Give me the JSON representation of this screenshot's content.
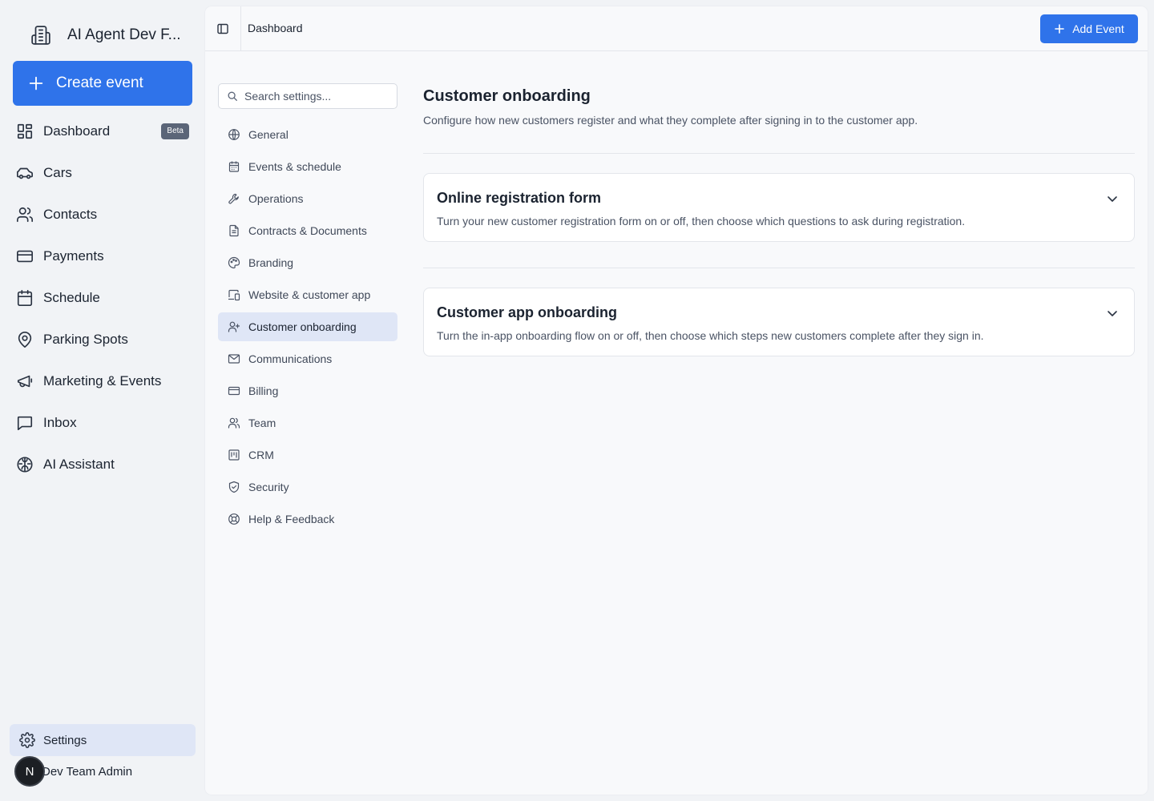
{
  "sidebar": {
    "brand_name": "AI Agent Dev F...",
    "create_label": "Create event",
    "items": [
      {
        "label": "Dashboard",
        "icon": "dashboard-icon",
        "badge": "Beta"
      },
      {
        "label": "Cars",
        "icon": "car-icon"
      },
      {
        "label": "Contacts",
        "icon": "users-icon"
      },
      {
        "label": "Payments",
        "icon": "credit-card-icon"
      },
      {
        "label": "Schedule",
        "icon": "calendar-icon"
      },
      {
        "label": "Parking Spots",
        "icon": "map-pin-icon"
      },
      {
        "label": "Marketing & Events",
        "icon": "megaphone-icon"
      },
      {
        "label": "Inbox",
        "icon": "message-icon"
      },
      {
        "label": "AI Assistant",
        "icon": "brain-icon"
      }
    ],
    "settings_label": "Settings",
    "user": {
      "initial": "N",
      "name": "Dev Team Admin"
    }
  },
  "header": {
    "breadcrumb": "Dashboard",
    "add_event_label": "Add Event"
  },
  "settings_nav": {
    "search_placeholder": "Search settings...",
    "items": [
      {
        "label": "General",
        "icon": "globe-icon"
      },
      {
        "label": "Events & schedule",
        "icon": "calendar-icon"
      },
      {
        "label": "Operations",
        "icon": "wrench-icon"
      },
      {
        "label": "Contracts & Documents",
        "icon": "document-icon"
      },
      {
        "label": "Branding",
        "icon": "palette-icon"
      },
      {
        "label": "Website & customer app",
        "icon": "devices-icon"
      },
      {
        "label": "Customer onboarding",
        "icon": "user-plus-icon",
        "active": true
      },
      {
        "label": "Communications",
        "icon": "mail-icon"
      },
      {
        "label": "Billing",
        "icon": "credit-card-icon"
      },
      {
        "label": "Team",
        "icon": "users-icon"
      },
      {
        "label": "CRM",
        "icon": "kanban-icon"
      },
      {
        "label": "Security",
        "icon": "shield-icon"
      },
      {
        "label": "Help & Feedback",
        "icon": "lifebuoy-icon"
      }
    ]
  },
  "content": {
    "title": "Customer onboarding",
    "description": "Configure how new customers register and what they complete after signing in to the customer app.",
    "sections": [
      {
        "title": "Online registration form",
        "description": "Turn your new customer registration form on or off, then choose which questions to ask during registration."
      },
      {
        "title": "Customer app onboarding",
        "description": "Turn the in-app onboarding flow on or off, then choose which steps new customers complete after they sign in."
      }
    ]
  },
  "colors": {
    "accent": "#2f73ea",
    "active_bg": "#dfe6f6",
    "sidebar_bg": "#f1f3f6"
  }
}
